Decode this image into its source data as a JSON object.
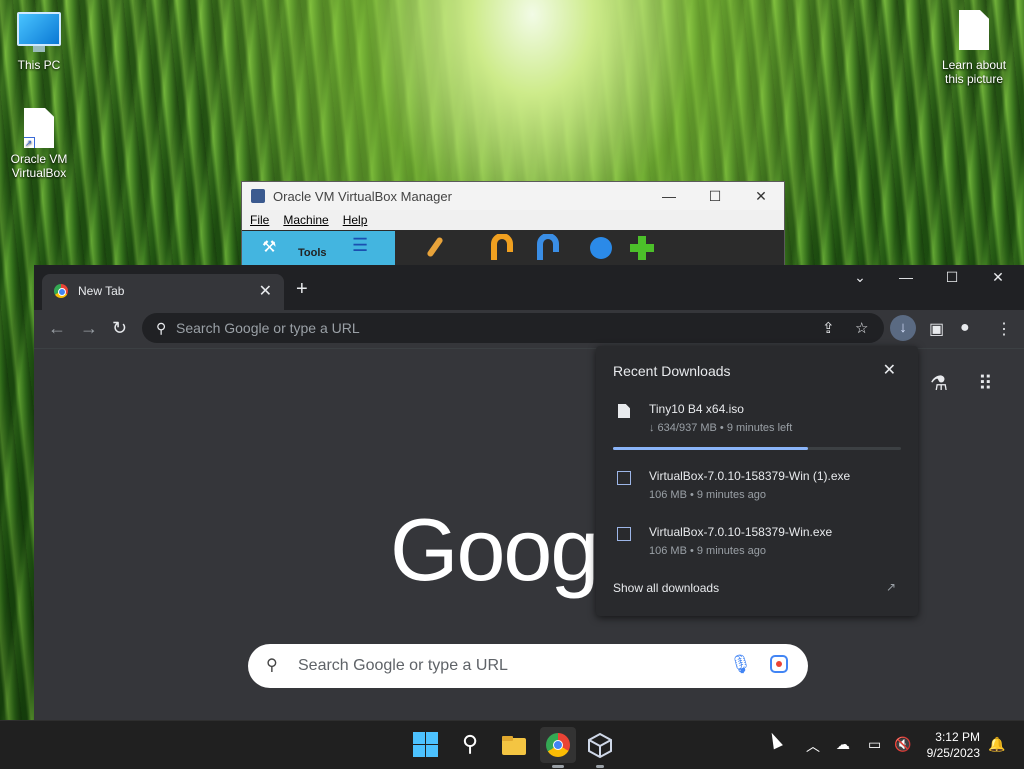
{
  "desktop": {
    "icons": [
      {
        "label": "This PC"
      },
      {
        "label": "Oracle VM VirtualBox"
      },
      {
        "label": "Learn about this picture"
      }
    ]
  },
  "virtualbox": {
    "title": "Oracle VM VirtualBox Manager",
    "menu": [
      "File",
      "Machine",
      "Help"
    ],
    "tools_label": "Tools"
  },
  "chrome": {
    "tab_title": "New Tab",
    "omnibox_placeholder": "Search Google or type a URL",
    "logo_text": "Goog",
    "search_placeholder": "Search Google or type a URL"
  },
  "downloads": {
    "heading": "Recent Downloads",
    "items": [
      {
        "name": "Tiny10 B4 x64.iso",
        "status": "↓ 634/937 MB • 9 minutes left",
        "progress": 0.677
      },
      {
        "name": "VirtualBox-7.0.10-158379-Win (1).exe",
        "status": "106 MB • 9 minutes ago"
      },
      {
        "name": "VirtualBox-7.0.10-158379-Win.exe",
        "status": "106 MB • 9 minutes ago"
      }
    ],
    "show_all": "Show all downloads"
  },
  "taskbar": {
    "time": "3:12 PM",
    "date": "9/25/2023"
  },
  "colors": {
    "accent": "#8ab4f8",
    "chrome_bg": "#35363a",
    "panel_bg": "#292a2d",
    "taskbar_bg": "#202020"
  }
}
